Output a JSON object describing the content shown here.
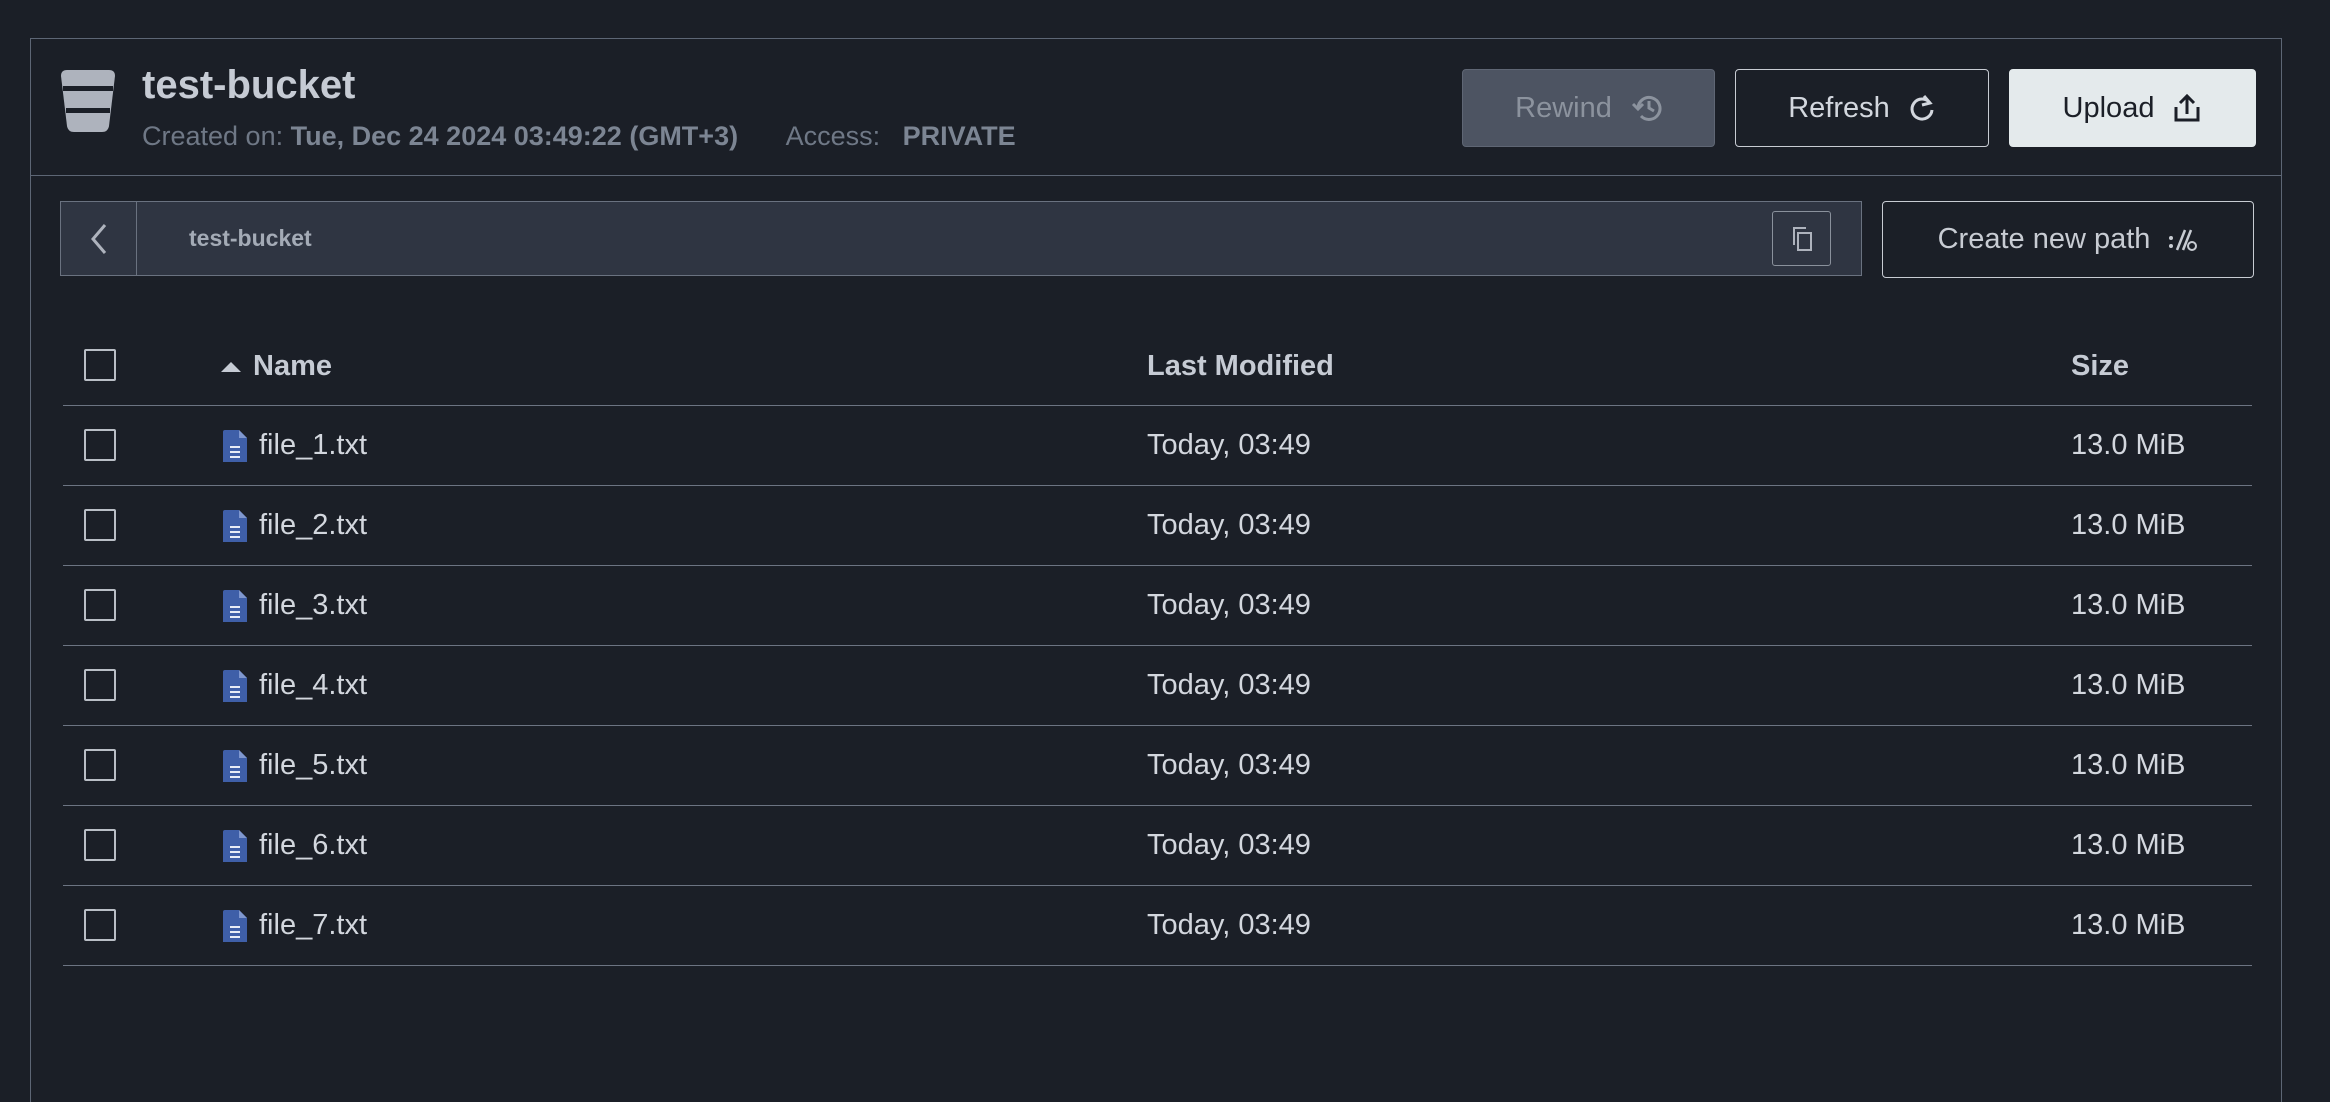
{
  "bucket": {
    "name": "test-bucket",
    "created_label": "Created on:",
    "created_value": "Tue, Dec 24 2024 03:49:22 (GMT+3)",
    "access_label": "Access:",
    "access_value": "PRIVATE"
  },
  "toolbar": {
    "rewind_label": "Rewind",
    "refresh_label": "Refresh",
    "upload_label": "Upload",
    "rewind_icon": "history-icon",
    "refresh_icon": "refresh-icon",
    "upload_icon": "upload-icon"
  },
  "path": {
    "current": "test-bucket",
    "back_icon": "chevron-left-icon",
    "copy_icon": "copy-icon",
    "create_label": "Create new path",
    "create_icon": "new-path-icon"
  },
  "table": {
    "columns": [
      "Name",
      "Last Modified",
      "Size"
    ],
    "sort_icon": "sort-ascending-icon",
    "file_icon": "text-file-icon",
    "rows": [
      {
        "name": "file_1.txt",
        "modified": "Today, 03:49",
        "size": "13.0 MiB"
      },
      {
        "name": "file_2.txt",
        "modified": "Today, 03:49",
        "size": "13.0 MiB"
      },
      {
        "name": "file_3.txt",
        "modified": "Today, 03:49",
        "size": "13.0 MiB"
      },
      {
        "name": "file_4.txt",
        "modified": "Today, 03:49",
        "size": "13.0 MiB"
      },
      {
        "name": "file_5.txt",
        "modified": "Today, 03:49",
        "size": "13.0 MiB"
      },
      {
        "name": "file_6.txt",
        "modified": "Today, 03:49",
        "size": "13.0 MiB"
      },
      {
        "name": "file_7.txt",
        "modified": "Today, 03:49",
        "size": "13.0 MiB"
      }
    ]
  },
  "colors": {
    "background": "#1b1f27",
    "file_icon": "#3f5fa8",
    "upload_bg": "#e4eaec",
    "rewind_bg": "#4d5462"
  }
}
